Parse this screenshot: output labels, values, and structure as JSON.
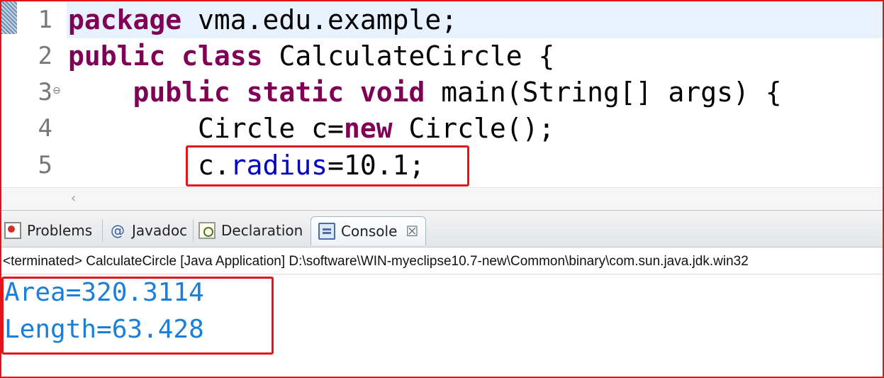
{
  "editor": {
    "line_numbers": [
      "1",
      "2",
      "3",
      "4",
      "5"
    ],
    "fold_marker": "⊖",
    "lines": [
      [
        {
          "t": "package",
          "c": "kw"
        },
        {
          "t": " vma.edu.example;",
          "c": ""
        }
      ],
      [
        {
          "t": "public",
          "c": "kw"
        },
        {
          "t": " ",
          "c": ""
        },
        {
          "t": "class",
          "c": "kw"
        },
        {
          "t": " CalculateCircle {",
          "c": ""
        }
      ],
      [
        {
          "t": "    ",
          "c": ""
        },
        {
          "t": "public",
          "c": "kw"
        },
        {
          "t": " ",
          "c": ""
        },
        {
          "t": "static",
          "c": "kw"
        },
        {
          "t": " ",
          "c": ""
        },
        {
          "t": "void",
          "c": "kw"
        },
        {
          "t": " main(String[] args) {",
          "c": ""
        }
      ],
      [
        {
          "t": "        Circle c=",
          "c": ""
        },
        {
          "t": "new",
          "c": "kw"
        },
        {
          "t": " Circle();",
          "c": ""
        }
      ],
      [
        {
          "t": "        c.",
          "c": ""
        },
        {
          "t": "radius",
          "c": "field"
        },
        {
          "t": "=10.1;",
          "c": ""
        }
      ]
    ],
    "scroll_left_glyph": "‹"
  },
  "tabs": {
    "problems": "Problems",
    "javadoc_icon": "@",
    "javadoc": "Javadoc",
    "declaration": "Declaration",
    "console": "Console",
    "console_close": "☒"
  },
  "console": {
    "status": "<terminated> CalculateCircle [Java Application] D:\\software\\WIN-myeclipse10.7-new\\Common\\binary\\com.sun.java.jdk.win32",
    "output": [
      "Area=320.3114",
      "Length=63.428"
    ]
  },
  "colors": {
    "keyword": "#7f0055",
    "field": "#0000c0",
    "console_output": "#1a7fd8",
    "highlight_box": "#e0161b"
  }
}
